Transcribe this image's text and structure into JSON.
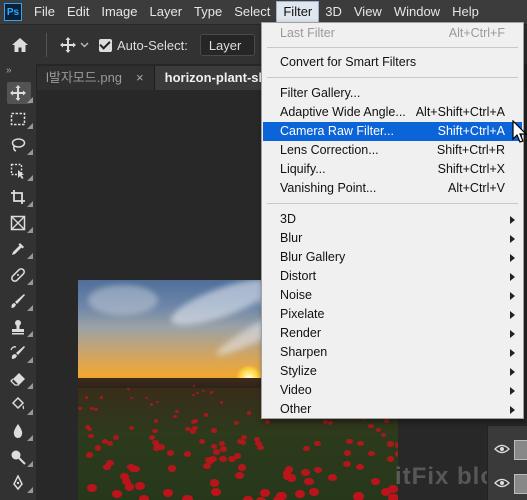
{
  "menubar": {
    "logo": "Ps",
    "items": [
      "File",
      "Edit",
      "Image",
      "Layer",
      "Type",
      "Select",
      "Filter",
      "3D",
      "View",
      "Window",
      "Help"
    ],
    "active": "Filter"
  },
  "options": {
    "auto_select_label": "Auto-Select:",
    "layer_value": "Layer"
  },
  "tabs": [
    {
      "label": "l발자모드.png",
      "close": "×"
    },
    {
      "label": "horizon-plant-sk.j",
      "close": ""
    }
  ],
  "toolbar": {
    "collapse": "»",
    "tools": [
      "move-tool",
      "rectangular-marquee-tool",
      "lasso-tool",
      "object-selection-tool",
      "crop-tool",
      "frame-tool",
      "eyedropper-tool",
      "healing-brush-tool",
      "brush-tool",
      "clone-stamp-tool",
      "history-brush-tool",
      "eraser-tool",
      "paint-bucket-tool",
      "blur-tool",
      "dodge-tool",
      "pen-tool"
    ]
  },
  "filter_menu": {
    "last_filter": {
      "label": "Last Filter",
      "shortcut": "Alt+Ctrl+F"
    },
    "convert_smart": "Convert for Smart Filters",
    "filter_gallery": "Filter Gallery...",
    "adaptive_wide": {
      "label": "Adaptive Wide Angle...",
      "shortcut": "Alt+Shift+Ctrl+A"
    },
    "camera_raw": {
      "label": "Camera Raw Filter...",
      "shortcut": "Shift+Ctrl+A"
    },
    "lens_correction": {
      "label": "Lens Correction...",
      "shortcut": "Shift+Ctrl+R"
    },
    "liquify": {
      "label": "Liquify...",
      "shortcut": "Shift+Ctrl+X"
    },
    "vanishing_point": {
      "label": "Vanishing Point...",
      "shortcut": "Alt+Ctrl+V"
    },
    "submenus": [
      "3D",
      "Blur",
      "Blur Gallery",
      "Distort",
      "Noise",
      "Pixelate",
      "Render",
      "Sharpen",
      "Stylize",
      "Video",
      "Other"
    ]
  },
  "watermark": "itFix blo",
  "colors": {
    "highlight": "#0b64d8",
    "menu_bg": "#f0f0f0",
    "app_bg": "#2b2b2b"
  }
}
